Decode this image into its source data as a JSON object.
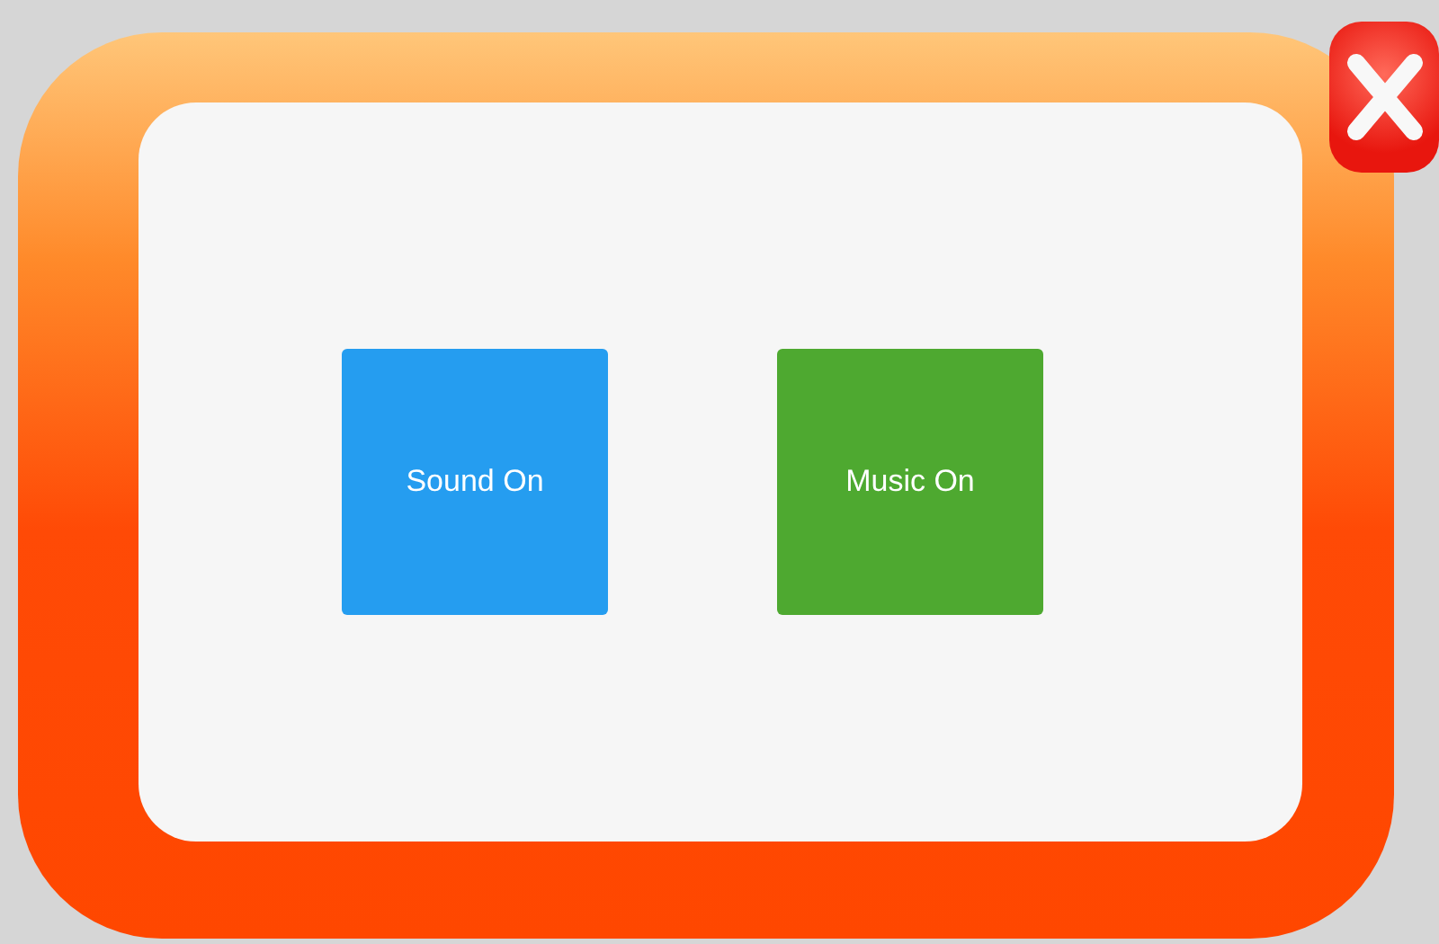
{
  "buttons": [
    {
      "label": "Sound On",
      "color": "#259df0"
    },
    {
      "label": "Music On",
      "color": "#4ea930"
    }
  ],
  "close_button": {
    "kind": "close"
  }
}
